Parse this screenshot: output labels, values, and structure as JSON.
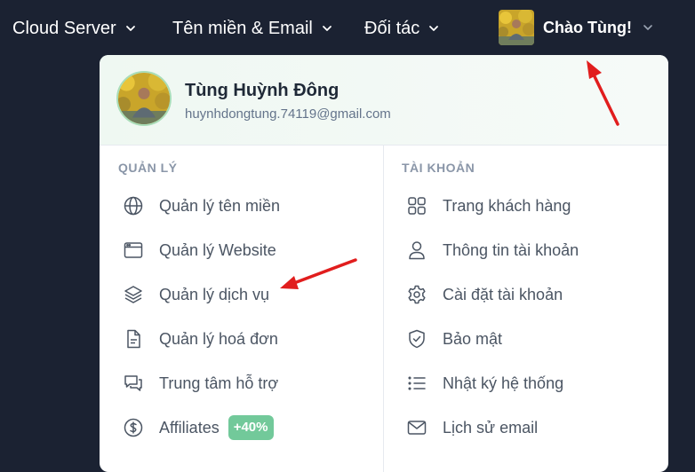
{
  "nav": {
    "items": [
      {
        "label": "Cloud Server"
      },
      {
        "label": "Tên miền & Email"
      },
      {
        "label": "Đối tác"
      }
    ],
    "user_greeting": "Chào Tùng!"
  },
  "profile": {
    "name": "Tùng Huỳnh Đông",
    "email": "huynhdongtung.74119@gmail.com"
  },
  "manage": {
    "title": "QUẢN LÝ",
    "items": [
      {
        "label": "Quản lý tên miền",
        "icon": "globe-icon"
      },
      {
        "label": "Quản lý Website",
        "icon": "browser-window-icon"
      },
      {
        "label": "Quản lý dịch vụ",
        "icon": "layers-icon"
      },
      {
        "label": "Quản lý hoá đơn",
        "icon": "document-icon"
      },
      {
        "label": "Trung tâm hỗ trợ",
        "icon": "chat-bubbles-icon"
      },
      {
        "label": "Affiliates",
        "icon": "dollar-coin-icon",
        "badge": "+40%"
      }
    ]
  },
  "account": {
    "title": "TÀI KHOẢN",
    "items": [
      {
        "label": "Trang khách hàng",
        "icon": "grid-icon"
      },
      {
        "label": "Thông tin tài khoản",
        "icon": "user-icon"
      },
      {
        "label": "Cài đặt tài khoản",
        "icon": "gear-icon"
      },
      {
        "label": "Bảo mật",
        "icon": "shield-check-icon"
      },
      {
        "label": "Nhật ký hệ thống",
        "icon": "list-icon"
      },
      {
        "label": "Lịch sử email",
        "icon": "mail-icon"
      }
    ]
  },
  "colors": {
    "nav_background": "#1b2232",
    "badge": "#72c99a",
    "annotation_arrow": "#e11d1d"
  }
}
